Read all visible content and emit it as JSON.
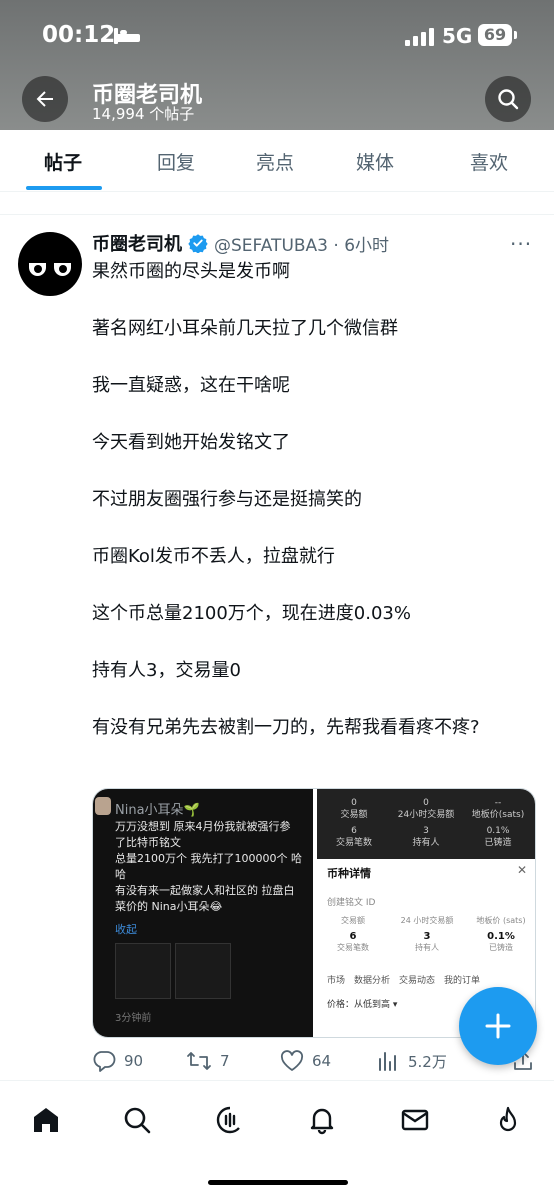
{
  "status_bar": {
    "time": "00:12",
    "network": "5G",
    "battery": "69"
  },
  "profile": {
    "name": "币圈老司机",
    "post_count": "14,994 个帖子"
  },
  "tabs": [
    {
      "label": "帖子",
      "active": true
    },
    {
      "label": "回复",
      "active": false
    },
    {
      "label": "亮点",
      "active": false
    },
    {
      "label": "媒体",
      "active": false
    },
    {
      "label": "喜欢",
      "active": false
    }
  ],
  "tweet": {
    "author_name": "币圈老司机",
    "handle_time": "@SEFATUBA3 · 6小时",
    "more": "···",
    "paragraphs": [
      "果然币圈的尽头是发币啊",
      "著名网红小耳朵前几天拉了几个微信群",
      "我一直疑惑，这在干啥呢",
      "今天看到她开始发铭文了",
      "不过朋友圈强行参与还是挺搞笑的",
      "币圈Kol发币不丢人，拉盘就行",
      "这个币总量2100万个，现在进度0.03%",
      "持有人3，交易量0",
      "有没有兄弟先去被割一刀的，先帮我看看疼不疼?"
    ],
    "media": {
      "left": {
        "poster": "Nina小耳朵🌱",
        "lines": [
          "万万没想到 原来4月份我就被强行参",
          "了比特币铭文",
          "总量2100万个 我先打了100000个 哈",
          "哈",
          "有没有来一起做家人和社区的 拉盘白",
          "菜价的 Nina小耳朵😂"
        ],
        "fold": "收起",
        "time": "3分钟前"
      },
      "right": {
        "top_cells": [
          {
            "value": "0",
            "label": "交易额"
          },
          {
            "value": "0",
            "label": "24小时交易额"
          },
          {
            "value": "--",
            "label": "地板价(sats)"
          },
          {
            "value": "6",
            "label": "交易笔数"
          },
          {
            "value": "3",
            "label": "持有人"
          },
          {
            "value": "0.1%",
            "label": "已铸造"
          }
        ],
        "title": "币种详情",
        "close": "✕",
        "subtitle": "创建铭文 ID",
        "row1": [
          {
            "label": "交易额",
            "value": ""
          },
          {
            "label": "24 小时交易额",
            "value": ""
          },
          {
            "label": "地板价 (sats)",
            "value": ""
          }
        ],
        "row2": [
          {
            "value": "6",
            "label": "交易笔数"
          },
          {
            "value": "3",
            "label": "持有人"
          },
          {
            "value": "0.1%",
            "label": "已铸造"
          }
        ],
        "tabs": "市场　数据分析　交易动态　我的订单",
        "sort": "价格：从低到高 ▾"
      }
    },
    "actions": {
      "replies": "90",
      "retweets": "7",
      "likes": "64",
      "views": "5.2万"
    }
  },
  "colors": {
    "accent": "#1d9bf0",
    "text": "#0f1419",
    "muted": "#536471"
  },
  "bottom_nav": [
    "home-icon",
    "search-icon",
    "spaces-icon",
    "notifications-icon",
    "messages-icon",
    "trending-icon"
  ]
}
